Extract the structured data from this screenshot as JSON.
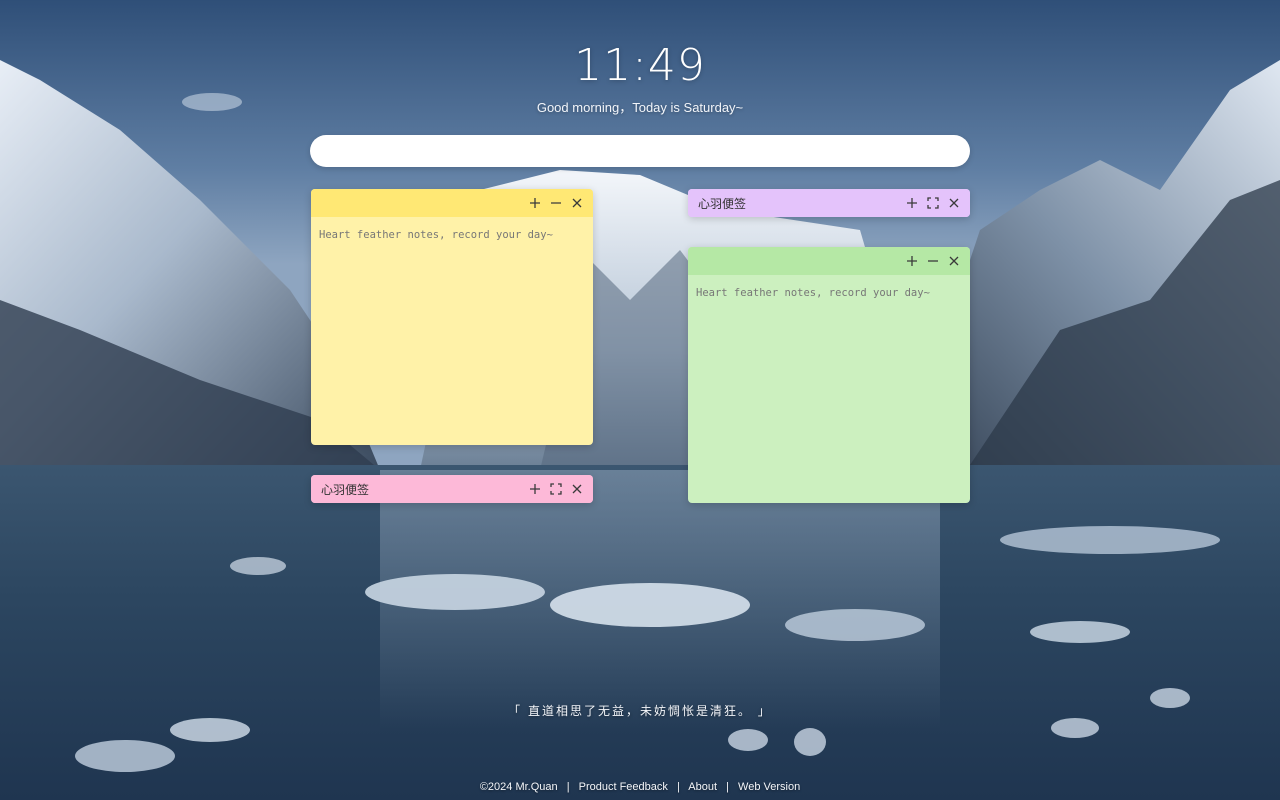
{
  "clock": {
    "time": "11:49",
    "greeting": "Good morning，Today is Saturday~"
  },
  "search": {
    "value": "",
    "placeholder": ""
  },
  "notes": [
    {
      "id": "yellow",
      "title": "",
      "placeholder": "Heart feather notes, record your day~",
      "header_color": "#ffe874",
      "body_color": "#fff2a8"
    },
    {
      "id": "purple",
      "title": "心羽便签",
      "header_color": "#e4c3fb"
    },
    {
      "id": "green",
      "title": "",
      "placeholder": "Heart feather notes, record your day~",
      "header_color": "#b5e8a5",
      "body_color": "#ccf0bf"
    },
    {
      "id": "pink",
      "title": "心羽便签",
      "header_color": "#fdb9d8"
    }
  ],
  "icons": {
    "add": "plus-icon",
    "minimize": "minus-icon",
    "expand": "expand-icon",
    "close": "close-icon"
  },
  "quote": "「 直道相思了无益，未妨惆怅是清狂。 」",
  "footer": {
    "copyright": "©2024  Mr.Quan",
    "links": [
      "Product Feedback",
      "About",
      "Web Version"
    ],
    "separator": "|"
  }
}
